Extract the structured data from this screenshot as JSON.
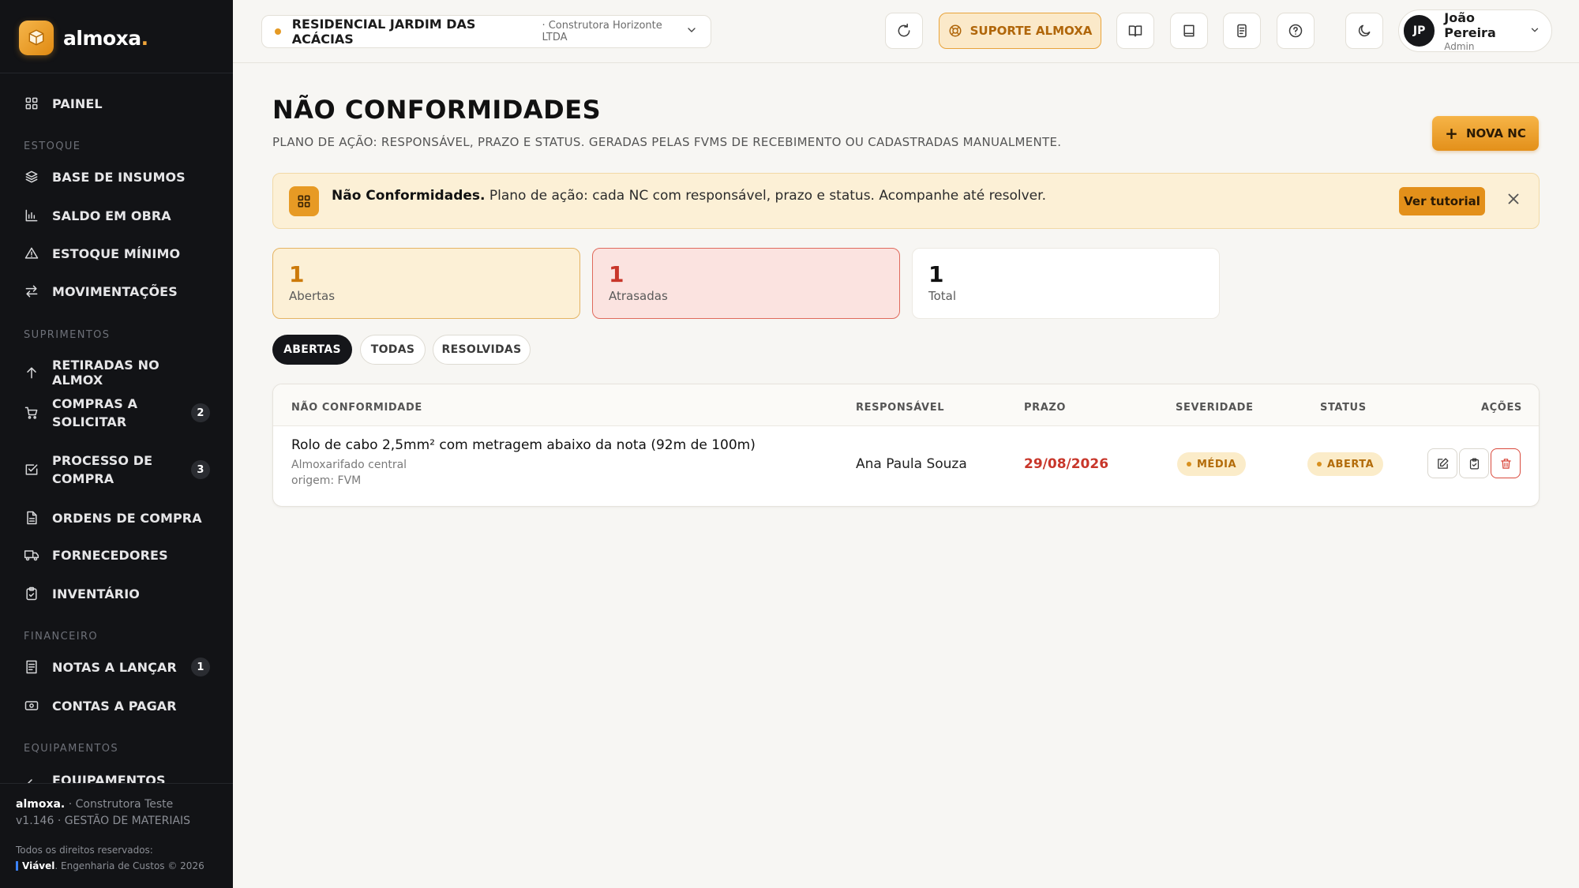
{
  "brand": {
    "name": "almoxa",
    "dot": "."
  },
  "sidebar": {
    "sections": {
      "estoque": "ESTOQUE",
      "suprimentos": "SUPRIMENTOS",
      "financeiro": "FINANCEIRO",
      "equipamentos": "EQUIPAMENTOS"
    },
    "items": {
      "painel": "PAINEL",
      "base_insumos": "BASE DE INSUMOS",
      "saldo_obra": "SALDO EM OBRA",
      "estoque_minimo": "ESTOQUE MÍNIMO",
      "movimentacoes": "MOVIMENTAÇÕES",
      "retiradas": "RETIRADAS NO ALMOX",
      "compras_a": "COMPRAS A",
      "compras_b": "SOLICITAR",
      "compras_badge": "2",
      "processo_a": "PROCESSO DE",
      "processo_b": "COMPRA",
      "processo_badge": "3",
      "ordens": "ORDENS DE COMPRA",
      "fornecedores": "FORNECEDORES",
      "inventario": "INVENTÁRIO",
      "notas": "NOTAS A LANÇAR",
      "notas_badge": "1",
      "contas": "CONTAS A PAGAR",
      "equipamentos": "EQUIPAMENTOS"
    },
    "footer": {
      "brand": "almoxa.",
      "company": " · Construtora Teste",
      "version": "v1.146 · GESTÃO DE MATERIAIS",
      "rights": "Todos os direitos reservados:",
      "credit_brand": "Viável",
      "credit_rest": ". Engenharia de Custos © 2026"
    }
  },
  "topbar": {
    "project_name": "RESIDENCIAL JARDIM DAS ACÁCIAS",
    "project_company": "· Construtora Horizonte LTDA",
    "support_label": "SUPORTE ALMOXA",
    "user_initials": "JP",
    "user_name": "João Pereira",
    "user_role": "Admin"
  },
  "page": {
    "title": "NÃO CONFORMIDADES",
    "subtitle": "PLANO DE AÇÃO: RESPONSÁVEL, PRAZO E STATUS. GERADAS PELAS FVMS DE RECEBIMENTO OU CADASTRADAS MANUALMENTE.",
    "new_button": "NOVA NC"
  },
  "banner": {
    "title": "Não Conformidades.",
    "text": " Plano de ação: cada NC com responsável, prazo e status. Acompanhe até resolver.",
    "tutorial_button": "Ver tutorial"
  },
  "stats": {
    "open_value": "1",
    "open_label": "Abertas",
    "late_value": "1",
    "late_label": "Atrasadas",
    "total_value": "1",
    "total_label": "Total"
  },
  "tabs": {
    "abertas": "ABERTAS",
    "todas": "TODAS",
    "resolvidas": "RESOLVIDAS"
  },
  "table": {
    "headers": {
      "nc": "NÃO CONFORMIDADE",
      "resp": "RESPONSÁVEL",
      "prazo": "PRAZO",
      "sev": "SEVERIDADE",
      "status": "STATUS",
      "acoes": "AÇÕES"
    },
    "rows": [
      {
        "title": "Rolo de cabo 2,5mm² com metragem abaixo da nota (92m de 100m)",
        "location": "Almoxarifado central",
        "origin": "origem: FVM",
        "responsible": "Ana Paula Souza",
        "deadline": "29/08/2026",
        "severity": "MÉDIA",
        "status": "ABERTA"
      }
    ]
  },
  "colors": {
    "accent": "#e79a24",
    "danger": "#c8362a",
    "sidebar": "#121316"
  }
}
